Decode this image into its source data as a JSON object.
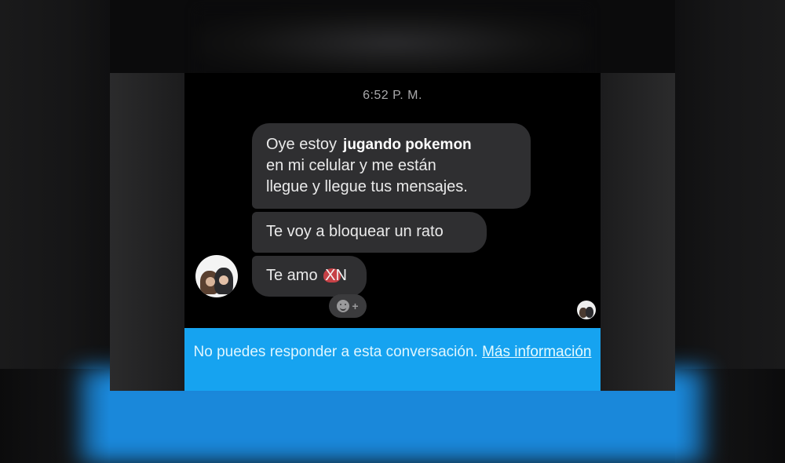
{
  "conversation": {
    "timestamp": "6:52 P. M.",
    "messages": [
      {
        "line1_prefix": "Oye estoy",
        "line1_overlay": "jugando pokemon",
        "line2": "en mi celular y me están",
        "line3": "llegue y llegue tus mensajes."
      },
      {
        "text": "Te voy a bloquear un rato"
      },
      {
        "text": "Te amo",
        "emoji_text": "XN"
      }
    ],
    "reaction_plus": "+"
  },
  "footer": {
    "notice": "No puedes responder a esta conversación.",
    "link": "Más información"
  },
  "colors": {
    "bubble": "#2f2f31",
    "footer": "#16a3f0",
    "heart": "#e0444a"
  }
}
